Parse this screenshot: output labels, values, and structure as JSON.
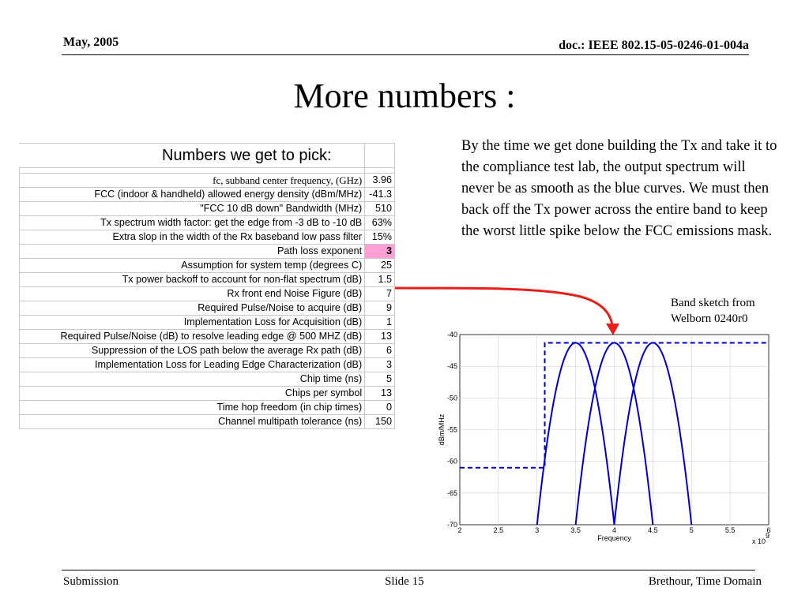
{
  "header": {
    "date": "May, 2005",
    "doc": "doc.: IEEE 802.15-05-0246-01-004a"
  },
  "title": "More numbers :",
  "sheet": {
    "heading": "Numbers we get to pick:",
    "rows": [
      {
        "label": "fc, subband center frequency, (GHz)",
        "value": "3.96"
      },
      {
        "label": "FCC (indoor & handheld) allowed energy density (dBm/MHz)",
        "value": "-41.3"
      },
      {
        "label": "\"FCC 10 dB down\" Bandwidth  (MHz)",
        "value": "510"
      },
      {
        "label": "Tx spectrum width factor: get the edge from -3 dB to -10 dB",
        "value": "63%"
      },
      {
        "label": "Extra slop in the width of the Rx baseband low pass filter",
        "value": "15%"
      },
      {
        "label": "Path loss exponent",
        "value": "3"
      },
      {
        "label": "Assumption for system temp (degrees C)",
        "value": "25"
      },
      {
        "label": "Tx power backoff to account for non-flat spectrum (dB)",
        "value": "1.5"
      },
      {
        "label": "Rx front end Noise Figure (dB)",
        "value": "7"
      },
      {
        "label": "Required Pulse/Noise to acquire (dB)",
        "value": "9"
      },
      {
        "label": "Implementation Loss for Acquisition (dB)",
        "value": "1"
      },
      {
        "label": "Required Pulse/Noise (dB) to resolve leading edge @ 500 MHZ (dB)",
        "value": "13"
      },
      {
        "label": "Suppression of the LOS path below the average Rx path (dB)",
        "value": "6"
      },
      {
        "label": "Implementation Loss for Leading Edge Characterization (dB)",
        "value": "3"
      },
      {
        "label": "Chip time (ns)",
        "value": "5"
      },
      {
        "label": "Chips per symbol",
        "value": "13"
      },
      {
        "label": "Time hop freedom (in chip times)",
        "value": "0"
      },
      {
        "label": "Channel multipath tolerance (ns)",
        "value": "150"
      }
    ],
    "highlight_color": "#ff9fd6"
  },
  "paragraph": "By the time we get done building the Tx and take it to the compliance test lab, the output spectrum will never be as smooth as the blue curves.  We must then back off the Tx power across the entire band to keep the worst little spike below the FCC emissions mask.",
  "band_note": "Band sketch from Welborn 0240r0",
  "arrow_color": "#e8201a",
  "chart_data": {
    "type": "line",
    "xlabel": "Frequency",
    "ylabel": "dBm/MHz",
    "x_exponent_label": "x 10",
    "x_exponent": "9",
    "xlim": [
      2,
      6
    ],
    "ylim": [
      -70,
      -40
    ],
    "xticks": [
      "2",
      "2.5",
      "3",
      "3.5",
      "4",
      "4.5",
      "5",
      "5.5",
      "6"
    ],
    "yticks": [
      "-40",
      "-45",
      "-50",
      "-55",
      "-60",
      "-65",
      "-70"
    ],
    "line_color": "#0000cc",
    "mask": {
      "style": "dashed",
      "x": [
        2,
        3.1,
        3.1,
        6
      ],
      "y": [
        -61,
        -61,
        -41.3,
        -41.3
      ]
    },
    "series": [
      {
        "center": 3.5,
        "half_width": 0.5,
        "peak": -41.3
      },
      {
        "center": 4.0,
        "half_width": 0.5,
        "peak": -41.3
      },
      {
        "center": 4.5,
        "half_width": 0.5,
        "peak": -41.3
      }
    ]
  },
  "footer": {
    "left": "Submission",
    "center": "Slide 15",
    "right": "Brethour, Time Domain"
  }
}
